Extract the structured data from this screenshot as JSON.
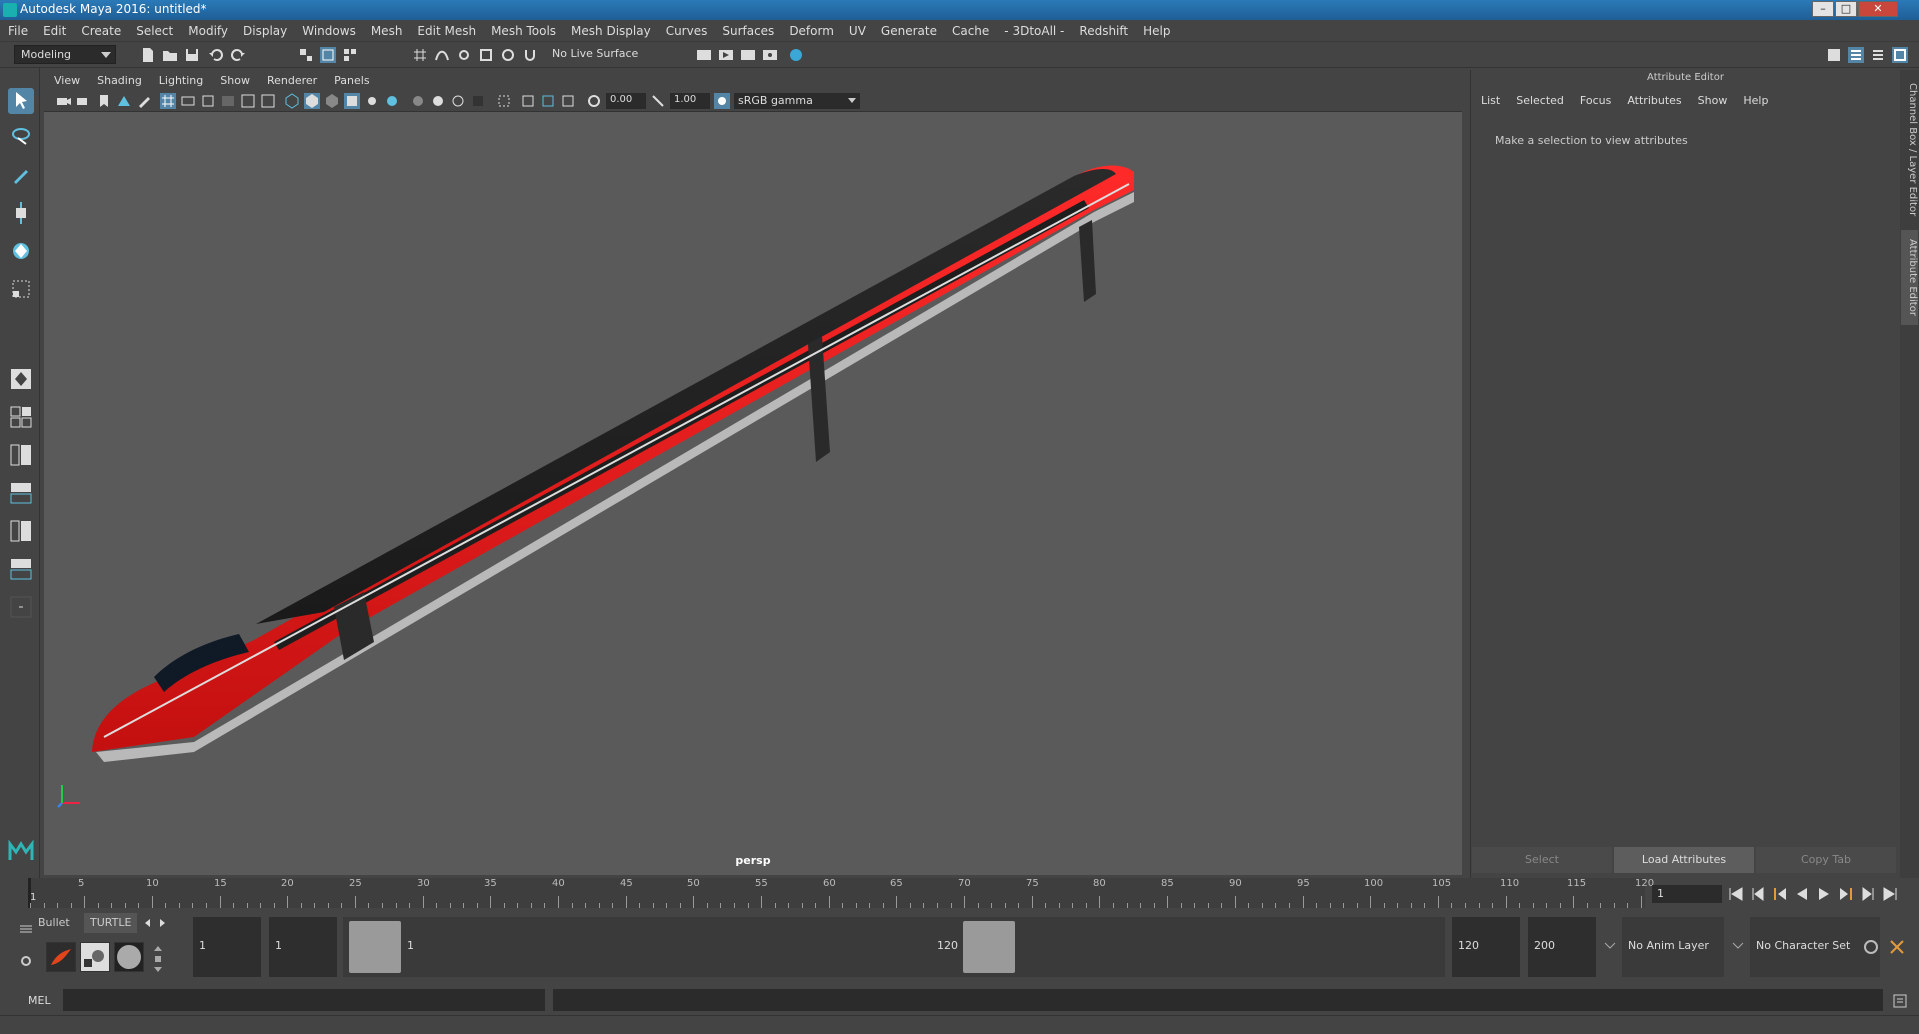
{
  "window": {
    "title": "Autodesk Maya 2016: untitled*",
    "minimize": "–",
    "maximize": "□",
    "close": "✕"
  },
  "menubar": [
    "File",
    "Edit",
    "Create",
    "Select",
    "Modify",
    "Display",
    "Windows",
    "Mesh",
    "Edit Mesh",
    "Mesh Tools",
    "Mesh Display",
    "Curves",
    "Surfaces",
    "Deform",
    "UV",
    "Generate",
    "Cache",
    "- 3DtoAll -",
    "Redshift",
    "Help"
  ],
  "statusline": {
    "mode": "Modeling",
    "live_surface": "No Live Surface"
  },
  "panel": {
    "menu": [
      "View",
      "Shading",
      "Lighting",
      "Show",
      "Renderer",
      "Panels"
    ],
    "exposure": "0.00",
    "gamma": "1.00",
    "color_space": "sRGB gamma",
    "camera": "persp"
  },
  "attribute_editor": {
    "title": "Attribute Editor",
    "menu": [
      "List",
      "Selected",
      "Focus",
      "Attributes",
      "Show",
      "Help"
    ],
    "message": "Make a selection to view attributes",
    "buttons": {
      "select": "Select",
      "load": "Load Attributes",
      "copy": "Copy Tab"
    }
  },
  "side_tabs": {
    "channel_box": "Channel Box / Layer Editor",
    "attribute_editor": "Attribute Editor"
  },
  "timeline": {
    "ticks": [
      "5",
      "10",
      "15",
      "20",
      "25",
      "30",
      "35",
      "40",
      "45",
      "50",
      "55",
      "60",
      "65",
      "70",
      "75",
      "80",
      "85",
      "90",
      "95",
      "100",
      "105",
      "110",
      "115",
      "120"
    ],
    "current_frame_marker": "1",
    "current_frame": "1"
  },
  "shelf": {
    "tabs": [
      "Bullet",
      "TURTLE"
    ]
  },
  "range": {
    "start": "1",
    "playback_start": "1",
    "range_start_label": "1",
    "range_end_label": "120",
    "playback_end": "120",
    "end": "200",
    "anim_layer": "No Anim Layer",
    "character_set": "No Character Set"
  },
  "cmdline": {
    "label": "MEL"
  }
}
